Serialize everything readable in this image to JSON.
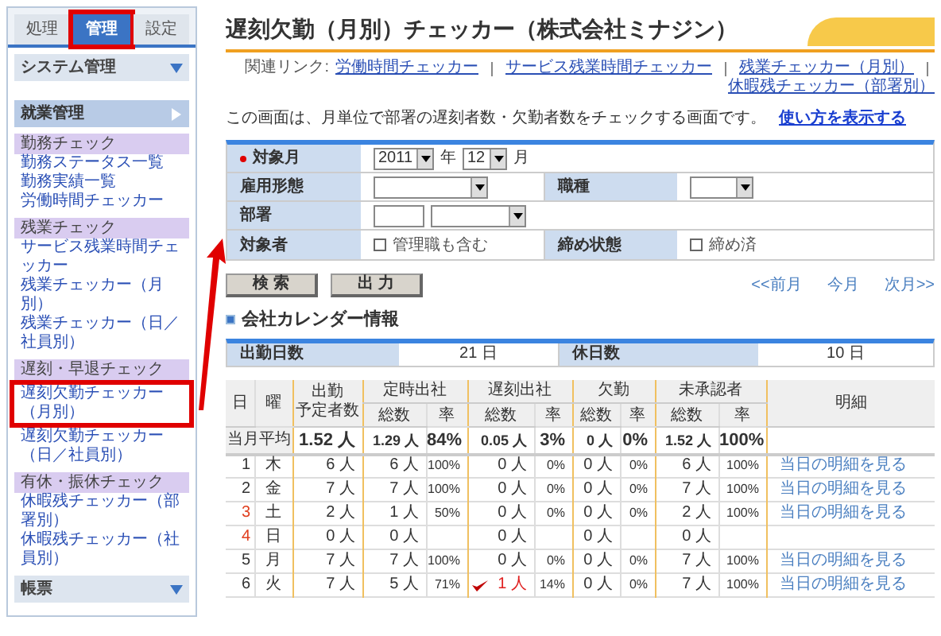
{
  "sidebar": {
    "tabs": [
      {
        "label": "処理",
        "selected": false,
        "highlighted": false
      },
      {
        "label": "管理",
        "selected": true,
        "highlighted": true
      },
      {
        "label": "設定",
        "selected": false,
        "highlighted": false
      }
    ],
    "sections": [
      {
        "label": "システム管理",
        "expanded": false
      },
      {
        "label": "就業管理",
        "expanded": true,
        "groups": [
          {
            "label": "勤務チェック",
            "items": [
              {
                "label": "勤務ステータス一覧",
                "highlighted": false
              },
              {
                "label": "勤務実績一覧",
                "highlighted": false
              },
              {
                "label": "労働時間チェッカー",
                "highlighted": false
              }
            ]
          },
          {
            "label": "残業チェック",
            "items": [
              {
                "label": "サービス残業時間チェッカー",
                "highlighted": false
              },
              {
                "label": "残業チェッカー（月別）",
                "highlighted": false
              },
              {
                "label": "残業チェッカー（日／社員別）",
                "highlighted": false
              }
            ]
          },
          {
            "label": "遅刻・早退チェック",
            "items": [
              {
                "label": "遅刻欠勤チェッカー（月別）",
                "highlighted": true
              },
              {
                "label": "遅刻欠勤チェッカー（日／社員別）",
                "highlighted": false
              }
            ]
          },
          {
            "label": "有休・振休チェック",
            "items": [
              {
                "label": "休暇残チェッカー（部署別）",
                "highlighted": false
              },
              {
                "label": "休暇残チェッカー（社員別）",
                "highlighted": false
              }
            ]
          }
        ]
      },
      {
        "label": "帳票",
        "expanded": false
      }
    ]
  },
  "main": {
    "title": "遅刻欠勤（月別）チェッカー（株式会社ミナジン）",
    "related_links": {
      "label": "関連リンク:",
      "links": [
        "労働時間チェッカー",
        "サービス残業時間チェッカー",
        "残業チェッカー（月別）",
        "休暇残チェッカー（部署別）"
      ]
    },
    "description": {
      "text": "この画面は、月単位で部署の遅刻者数・欠勤者数をチェックする画面です。",
      "link": "使い方を表示する"
    },
    "form": {
      "target_month": {
        "label": "対象月",
        "required": true,
        "year": "2011",
        "year_unit": "年",
        "month": "12",
        "month_unit": "月"
      },
      "employment_type": {
        "label": "雇用形態"
      },
      "job_type": {
        "label": "職種"
      },
      "department": {
        "label": "部署"
      },
      "target": {
        "label": "対象者",
        "checkbox": {
          "label": "管理職も含む",
          "checked": false
        }
      },
      "closing": {
        "label": "締め状態",
        "checkbox": {
          "label": "締め済",
          "checked": false
        }
      }
    },
    "buttons": [
      "検 索",
      "出 力"
    ],
    "month_nav": [
      "<<前月",
      "今月",
      "次月>>"
    ],
    "calendar": {
      "title": "会社カレンダー情報",
      "work_days_label": "出勤日数",
      "work_days": "21 日",
      "holidays_label": "休日数",
      "holidays": "10 日"
    },
    "table": {
      "head": {
        "day": "日",
        "weekday": "曜",
        "scheduled": [
          "出勤",
          "予定者数"
        ],
        "groups": [
          "定時出社",
          "遅刻出社",
          "欠勤",
          "未承認者"
        ],
        "subheads": [
          "総数",
          "率",
          "総数",
          "率",
          "総数",
          "率",
          "総数",
          "率"
        ],
        "detail": "明細"
      },
      "average": {
        "label": "当月平均",
        "values": [
          "1.52 人",
          "1.29 人",
          "84%",
          "0.05 人",
          "3%",
          "0 人",
          "0%",
          "1.52 人",
          "100%"
        ]
      },
      "rows": [
        {
          "day": "1",
          "weekday": "木",
          "holiday": false,
          "flagged": false,
          "values": [
            "6 人",
            "6 人",
            "100%",
            "0 人",
            "0%",
            "0 人",
            "0%",
            "6 人",
            "100%"
          ],
          "detail": "当日の明細を見る"
        },
        {
          "day": "2",
          "weekday": "金",
          "holiday": false,
          "flagged": false,
          "values": [
            "7 人",
            "7 人",
            "100%",
            "0 人",
            "0%",
            "0 人",
            "0%",
            "7 人",
            "100%"
          ],
          "detail": "当日の明細を見る"
        },
        {
          "day": "3",
          "weekday": "土",
          "holiday": true,
          "flagged": false,
          "values": [
            "2 人",
            "1 人",
            "50%",
            "0 人",
            "0%",
            "0 人",
            "0%",
            "2 人",
            "100%"
          ],
          "detail": "当日の明細を見る"
        },
        {
          "day": "4",
          "weekday": "日",
          "holiday": true,
          "flagged": false,
          "values": {
            "scheduled": "0 人",
            "ontime_count": "0 人",
            "late_count": "0 人",
            "absent_count": "0 人",
            "unapproved_count": "0 人"
          }
        },
        {
          "day": "5",
          "weekday": "月",
          "holiday": false,
          "flagged": false,
          "values": [
            "7 人",
            "7 人",
            "100%",
            "0 人",
            "0%",
            "0 人",
            "0%",
            "7 人",
            "100%"
          ],
          "detail": "当日の明細を見る"
        },
        {
          "day": "6",
          "weekday": "火",
          "holiday": false,
          "flagged": true,
          "values": [
            "7 人",
            "5 人",
            "71%",
            "1 人",
            "14%",
            "0 人",
            "0%",
            "7 人",
            "100%"
          ],
          "detail": "当日の明細を見る"
        }
      ]
    }
  }
}
